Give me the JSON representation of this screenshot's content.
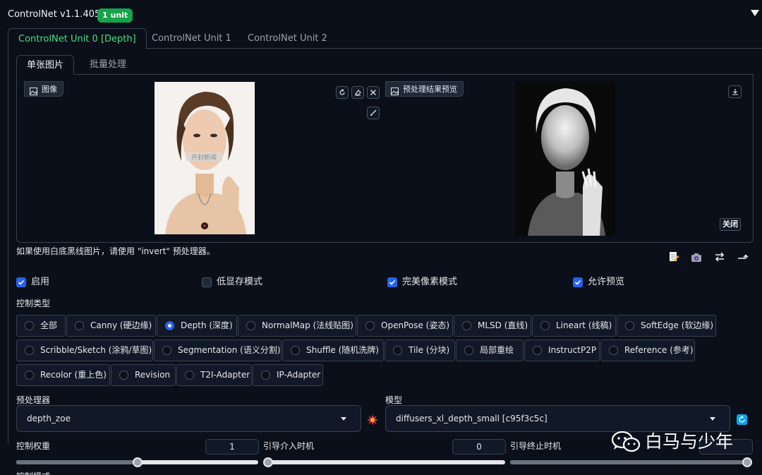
{
  "header": {
    "title": "ControlNet v1.1.405",
    "badge": "1 unit"
  },
  "unit_tabs": [
    {
      "label": "ControlNet Unit 0 [Depth]",
      "active": true
    },
    {
      "label": "ControlNet Unit 1",
      "active": false
    },
    {
      "label": "ControlNet Unit 2",
      "active": false
    }
  ],
  "sub_tabs": [
    {
      "label": "单张图片",
      "active": true
    },
    {
      "label": "批量处理",
      "active": false
    }
  ],
  "image_panel": {
    "input_label": "图像",
    "preview_label": "预处理结果预览",
    "close_label": "关闭",
    "watermark_text": "开封新闻"
  },
  "hint": "如果使用白底黑线图片，请使用 \"invert\" 预处理器。",
  "checkboxes": [
    {
      "label": "启用",
      "checked": true
    },
    {
      "label": "低显存模式",
      "checked": false
    },
    {
      "label": "完美像素模式",
      "checked": true
    },
    {
      "label": "允许预览",
      "checked": true
    }
  ],
  "control_type": {
    "label": "控制类型",
    "options": [
      {
        "label": "全部",
        "selected": false
      },
      {
        "label": "Canny (硬边缘)",
        "selected": false
      },
      {
        "label": "Depth (深度)",
        "selected": true
      },
      {
        "label": "NormalMap (法线贴图)",
        "selected": false
      },
      {
        "label": "OpenPose (姿态)",
        "selected": false
      },
      {
        "label": "MLSD (直线)",
        "selected": false
      },
      {
        "label": "Lineart (线稿)",
        "selected": false
      },
      {
        "label": "SoftEdge (软边缘)",
        "selected": false
      },
      {
        "label": "Scribble/Sketch (涂鸦/草图)",
        "selected": false
      },
      {
        "label": "Segmentation (语义分割)",
        "selected": false
      },
      {
        "label": "Shuffle (随机洗牌)",
        "selected": false
      },
      {
        "label": "Tile (分块)",
        "selected": false
      },
      {
        "label": "局部重绘",
        "selected": false
      },
      {
        "label": "InstructP2P",
        "selected": false
      },
      {
        "label": "Reference (参考)",
        "selected": false
      },
      {
        "label": "Recolor (重上色)",
        "selected": false
      },
      {
        "label": "Revision",
        "selected": false
      },
      {
        "label": "T2I-Adapter",
        "selected": false
      },
      {
        "label": "IP-Adapter",
        "selected": false
      }
    ]
  },
  "preprocessor": {
    "label": "预处理器",
    "value": "depth_zoe"
  },
  "model": {
    "label": "模型",
    "value": "diffusers_xl_depth_small [c95f3c5c]"
  },
  "sliders": {
    "weight": {
      "label": "控制权重",
      "value": "1",
      "fraction": 0.5
    },
    "start": {
      "label": "引导介入时机",
      "value": "0",
      "fraction": 0.0
    },
    "end": {
      "label": "引导终止时机",
      "value": "",
      "fraction": 1.0
    }
  },
  "watermark": {
    "text": "白马与少年"
  },
  "next_section_label": "控制模式",
  "colors": {
    "background": "#0b0f19",
    "accent_green": "#4ade80",
    "badge_green": "#16a34a",
    "accent_blue": "#2563eb"
  }
}
